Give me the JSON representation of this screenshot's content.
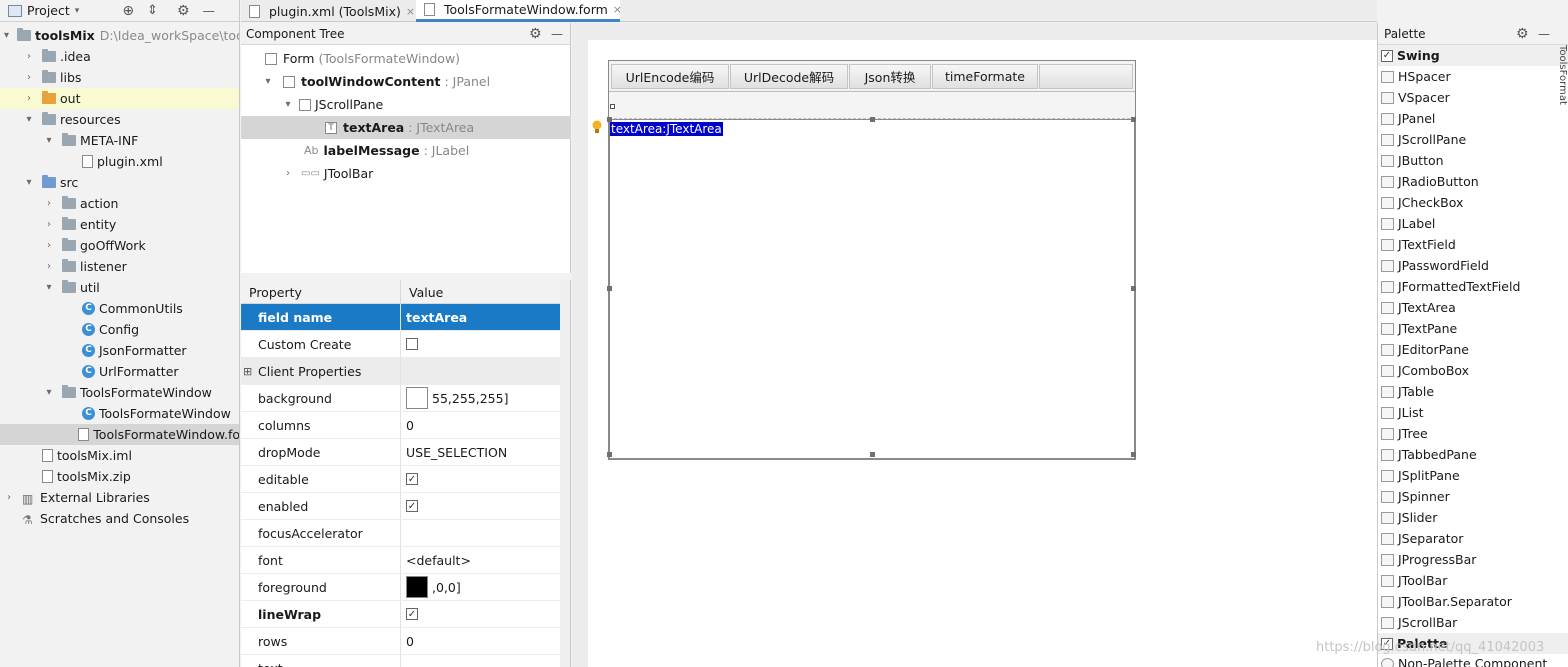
{
  "project_panel": {
    "title": "Project",
    "tree": [
      {
        "label": "toolsMix",
        "extra": "D:\\Idea_workSpace\\too",
        "icon": "module-folder-icon",
        "expander": "▾"
      },
      {
        "label": ".idea",
        "icon": "folder-icon",
        "expander": "›"
      },
      {
        "label": "libs",
        "icon": "folder-icon",
        "expander": "›"
      },
      {
        "label": "out",
        "icon": "folder-orange-icon",
        "expander": "›"
      },
      {
        "label": "resources",
        "icon": "folder-icon",
        "expander": "▾"
      },
      {
        "label": "META-INF",
        "icon": "folder-icon",
        "expander": "▾"
      },
      {
        "label": "plugin.xml",
        "icon": "xml-file-icon",
        "expander": ""
      },
      {
        "label": "src",
        "icon": "folder-blue-icon",
        "expander": "▾"
      },
      {
        "label": "action",
        "icon": "package-icon",
        "expander": "›"
      },
      {
        "label": "entity",
        "icon": "package-icon",
        "expander": "›"
      },
      {
        "label": "goOffWork",
        "icon": "package-icon",
        "expander": "›"
      },
      {
        "label": "listener",
        "icon": "package-icon",
        "expander": "›"
      },
      {
        "label": "util",
        "icon": "package-icon",
        "expander": "▾"
      },
      {
        "label": "CommonUtils",
        "icon": "class-icon",
        "expander": ""
      },
      {
        "label": "Config",
        "icon": "class-icon",
        "expander": ""
      },
      {
        "label": "JsonFormatter",
        "icon": "class-icon",
        "expander": ""
      },
      {
        "label": "UrlFormatter",
        "icon": "class-icon",
        "expander": ""
      },
      {
        "label": "ToolsFormateWindow",
        "icon": "form-folder-icon",
        "expander": "▾"
      },
      {
        "label": "ToolsFormateWindow",
        "icon": "class-icon",
        "expander": ""
      },
      {
        "label": "ToolsFormateWindow.fo",
        "icon": "form-file-icon",
        "expander": ""
      },
      {
        "label": "toolsMix.iml",
        "icon": "iml-file-icon",
        "expander": ""
      },
      {
        "label": "toolsMix.zip",
        "icon": "zip-file-icon",
        "expander": ""
      },
      {
        "label": "External Libraries",
        "icon": "libraries-icon",
        "expander": "›"
      },
      {
        "label": "Scratches and Consoles",
        "icon": "scratches-icon",
        "expander": ""
      }
    ]
  },
  "tabs": [
    {
      "label": "plugin.xml (ToolsMix)",
      "close": "×"
    },
    {
      "label": "ToolsFormateWindow.form",
      "close": "×"
    }
  ],
  "component_tree": {
    "title": "Component Tree",
    "rows": [
      {
        "name": "Form",
        "type": "(ToolsFormateWindow)"
      },
      {
        "name": "toolWindowContent",
        "type": ": JPanel"
      },
      {
        "name": "JScrollPane",
        "type": ""
      },
      {
        "name": "textArea",
        "type": ": JTextArea"
      },
      {
        "name": "labelMessage",
        "type": ": JLabel"
      },
      {
        "name": "JToolBar",
        "type": ""
      }
    ]
  },
  "properties": {
    "col_property": "Property",
    "col_value": "Value",
    "rows": [
      {
        "key": "field name",
        "value": "textArea"
      },
      {
        "key": "Custom Create",
        "value": ""
      },
      {
        "key": "Client Properties",
        "value": ""
      },
      {
        "key": "background",
        "value": "55,255,255]"
      },
      {
        "key": "columns",
        "value": "0"
      },
      {
        "key": "dropMode",
        "value": "USE_SELECTION"
      },
      {
        "key": "editable",
        "value": ""
      },
      {
        "key": "enabled",
        "value": ""
      },
      {
        "key": "focusAccelerator",
        "value": ""
      },
      {
        "key": "font",
        "value": "<default>"
      },
      {
        "key": "foreground",
        "value": ",0,0]"
      },
      {
        "key": "lineWrap",
        "value": ""
      },
      {
        "key": "rows",
        "value": "0"
      },
      {
        "key": "text",
        "value": ""
      }
    ]
  },
  "designer": {
    "buttons": [
      "UrlEncode编码",
      "UrlDecode解码",
      "Json转换",
      "timeFormate"
    ],
    "textarea_label": "textArea:JTextArea"
  },
  "palette": {
    "title": "Palette",
    "groups": {
      "swing": "Swing",
      "palette": "Palette"
    },
    "items": [
      "HSpacer",
      "VSpacer",
      "JPanel",
      "JScrollPane",
      "JButton",
      "JRadioButton",
      "JCheckBox",
      "JLabel",
      "JTextField",
      "JPasswordField",
      "JFormattedTextField",
      "JTextArea",
      "JTextPane",
      "JEditorPane",
      "JComboBox",
      "JTable",
      "JList",
      "JTree",
      "JTabbedPane",
      "JSplitPane",
      "JSpinner",
      "JSlider",
      "JSeparator",
      "JProgressBar",
      "JToolBar",
      "JToolBar.Separator",
      "JScrollBar"
    ],
    "non_palette": "Non-Palette Component",
    "side_tab": "ToolsFormate"
  },
  "watermark": "https://blog.csdn.net/qq_41042003",
  "colors": {
    "selection": "#1b7ac5",
    "accent_tab": "#4083c9",
    "textarea_label_bg": "#0000cc"
  }
}
